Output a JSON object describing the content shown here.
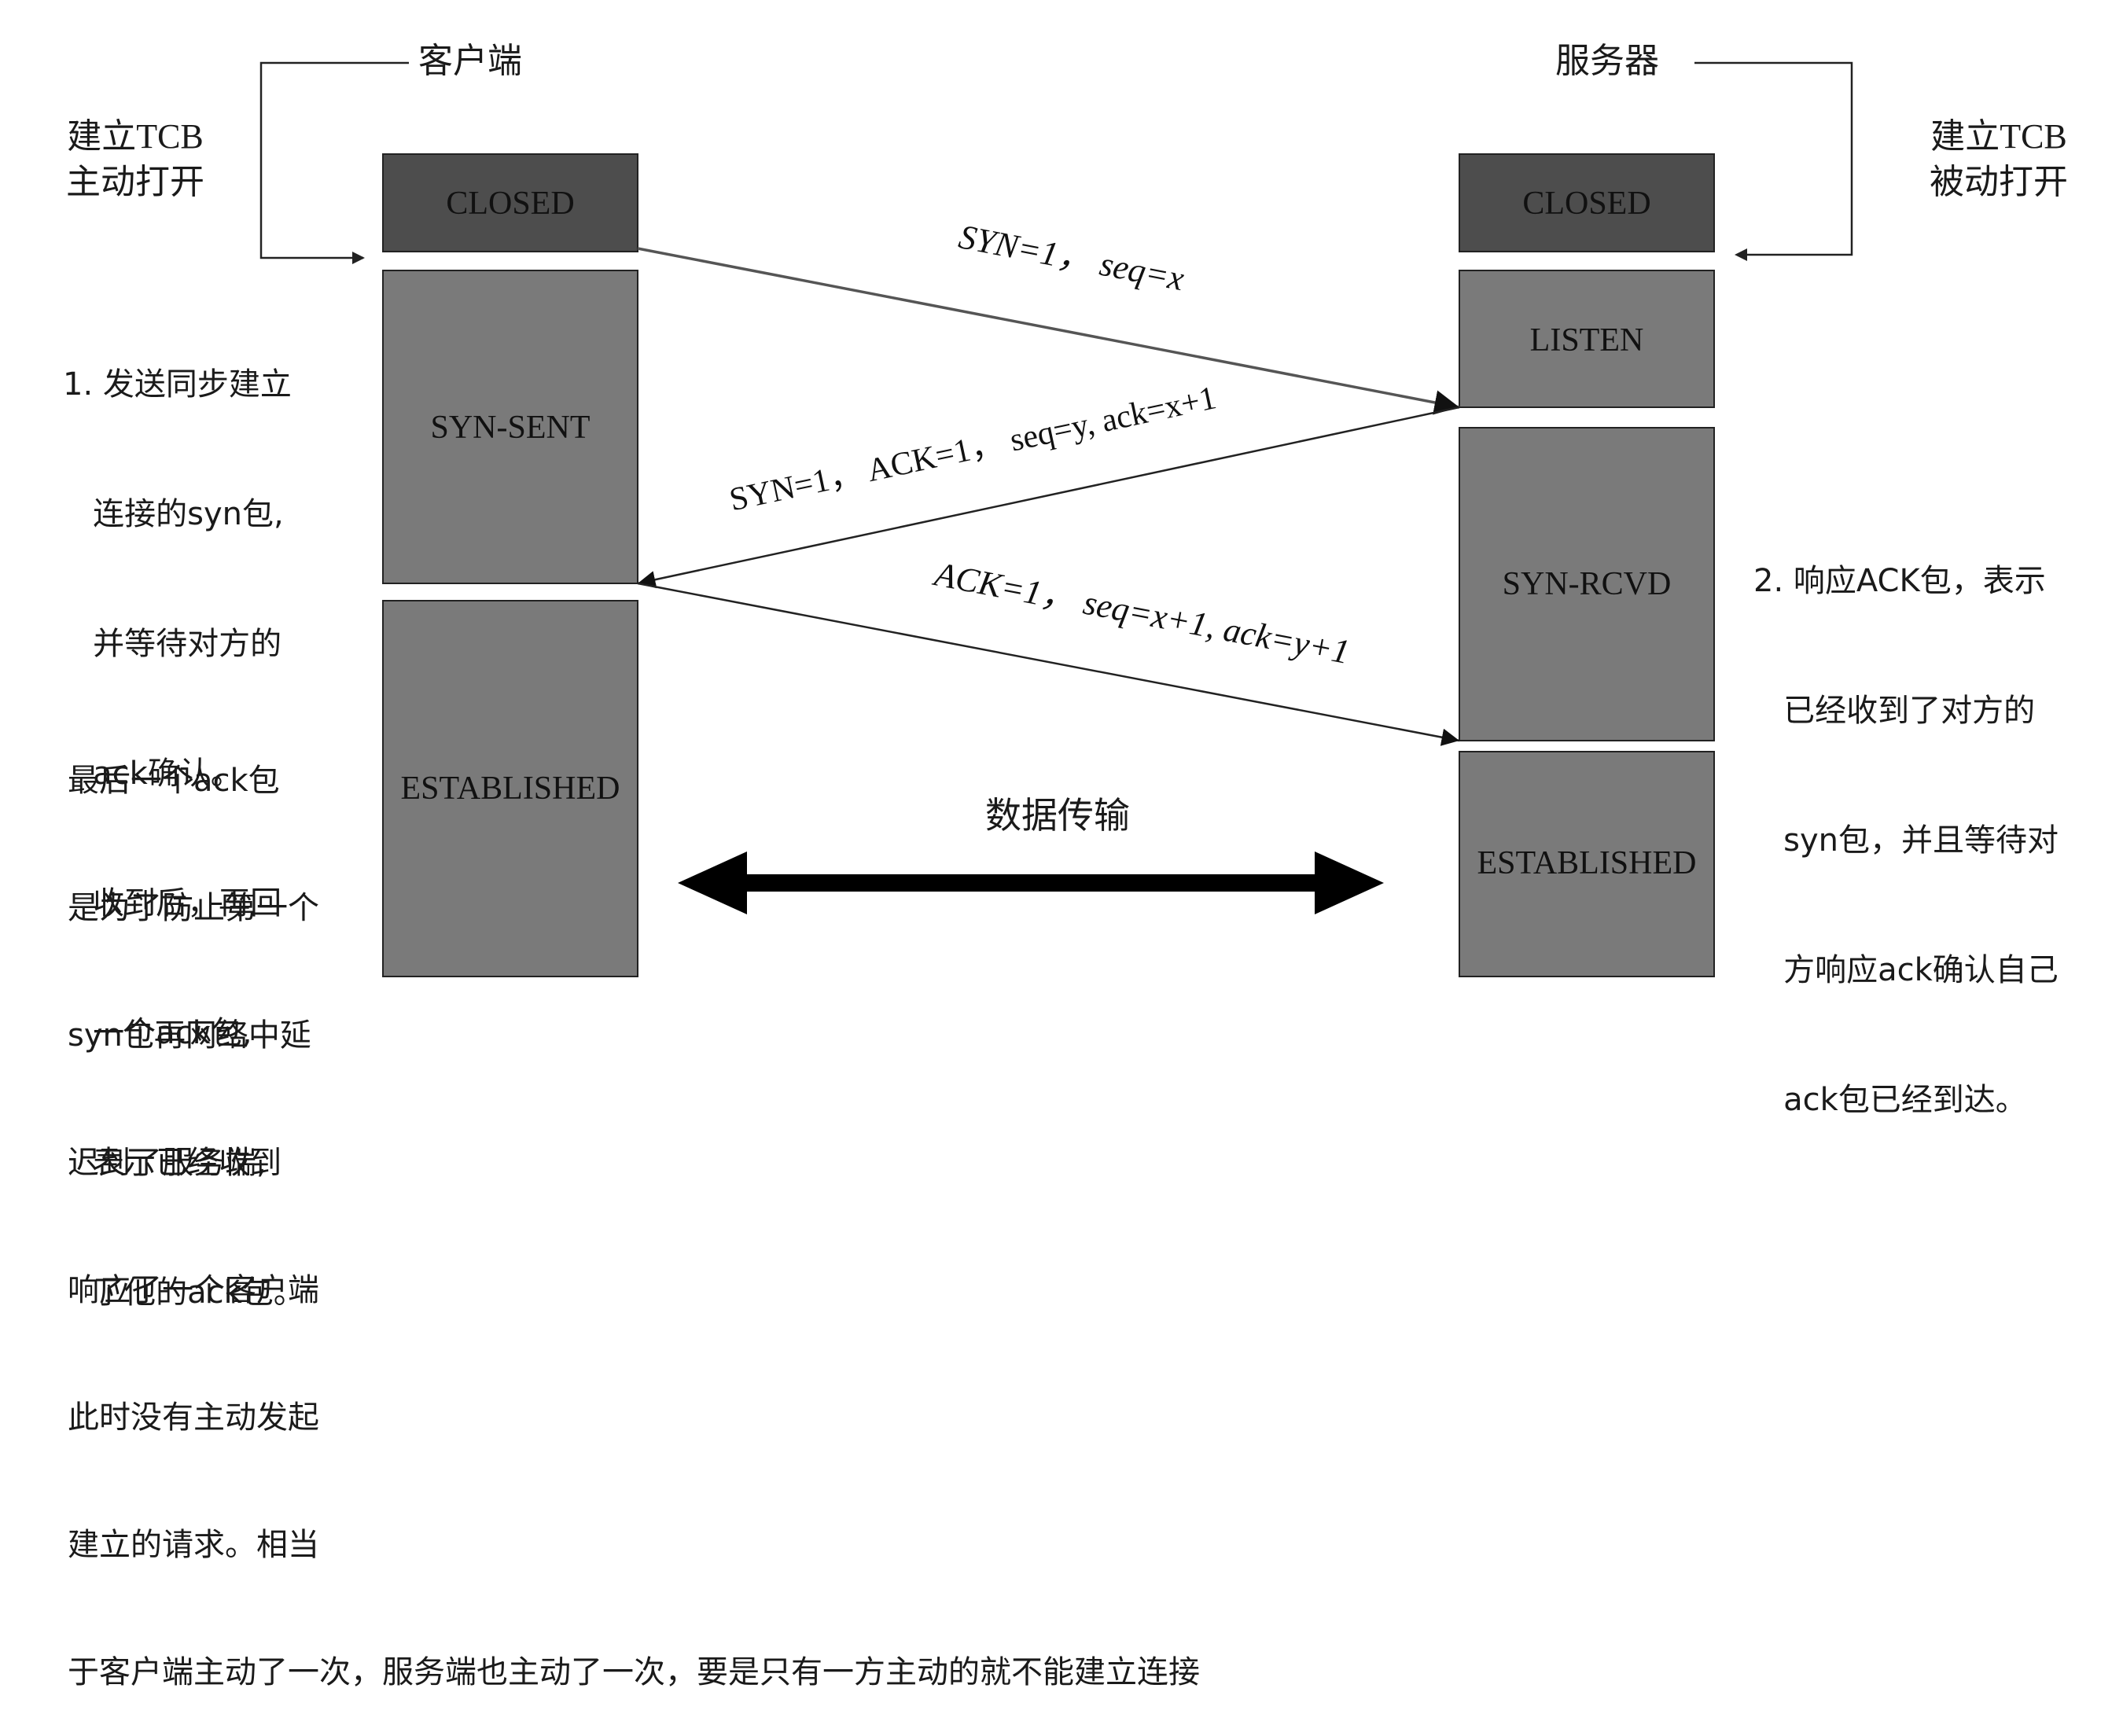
{
  "client": {
    "title": "客户端",
    "action_line1": "建立TCB",
    "action_line2": "主动打开",
    "states": [
      "CLOSED",
      "SYN-SENT",
      "ESTABLISHED"
    ],
    "note1": [
      "1. 发送同步建立",
      "   连接的syn包,",
      "   并等待对方的",
      "   ack确认。",
      "   收到后，再回",
      "   一个ack包,",
      "   表示已经收到",
      "   了他的ack包。"
    ],
    "note3": [
      "最后一个ack包",
      "是为了防止第一个",
      "syn包再网络中延",
      "迟到了服务端,",
      "响应了一个客户端",
      "此时没有主动发起",
      "建立的请求。相当",
      "于客户端主动了一次，服务端也主动了一次，要是只有一方主动的就不能建立连接"
    ]
  },
  "server": {
    "title": "服务器",
    "action_line1": "建立TCB",
    "action_line2": "被动打开",
    "states": [
      "CLOSED",
      "LISTEN",
      "SYN-RCVD",
      "ESTABLISHED"
    ],
    "note2": [
      "2. 响应ACK包，表示",
      "   已经收到了对方的",
      "   syn包，并且等待对",
      "   方响应ack确认自己",
      "   ack包已经到达。"
    ]
  },
  "messages": [
    "SYN=1，  seq=x",
    "SYN=1，  ACK=1，  seq=y, ack=x+1",
    "ACK=1，  seq=x+1, ack=y+1"
  ],
  "data_transfer": "数据传输",
  "colors": {
    "closed_fill": "#4d4d4d",
    "state_fill": "#7a7a7a",
    "border": "#222222",
    "text": "#1a1a1a"
  }
}
